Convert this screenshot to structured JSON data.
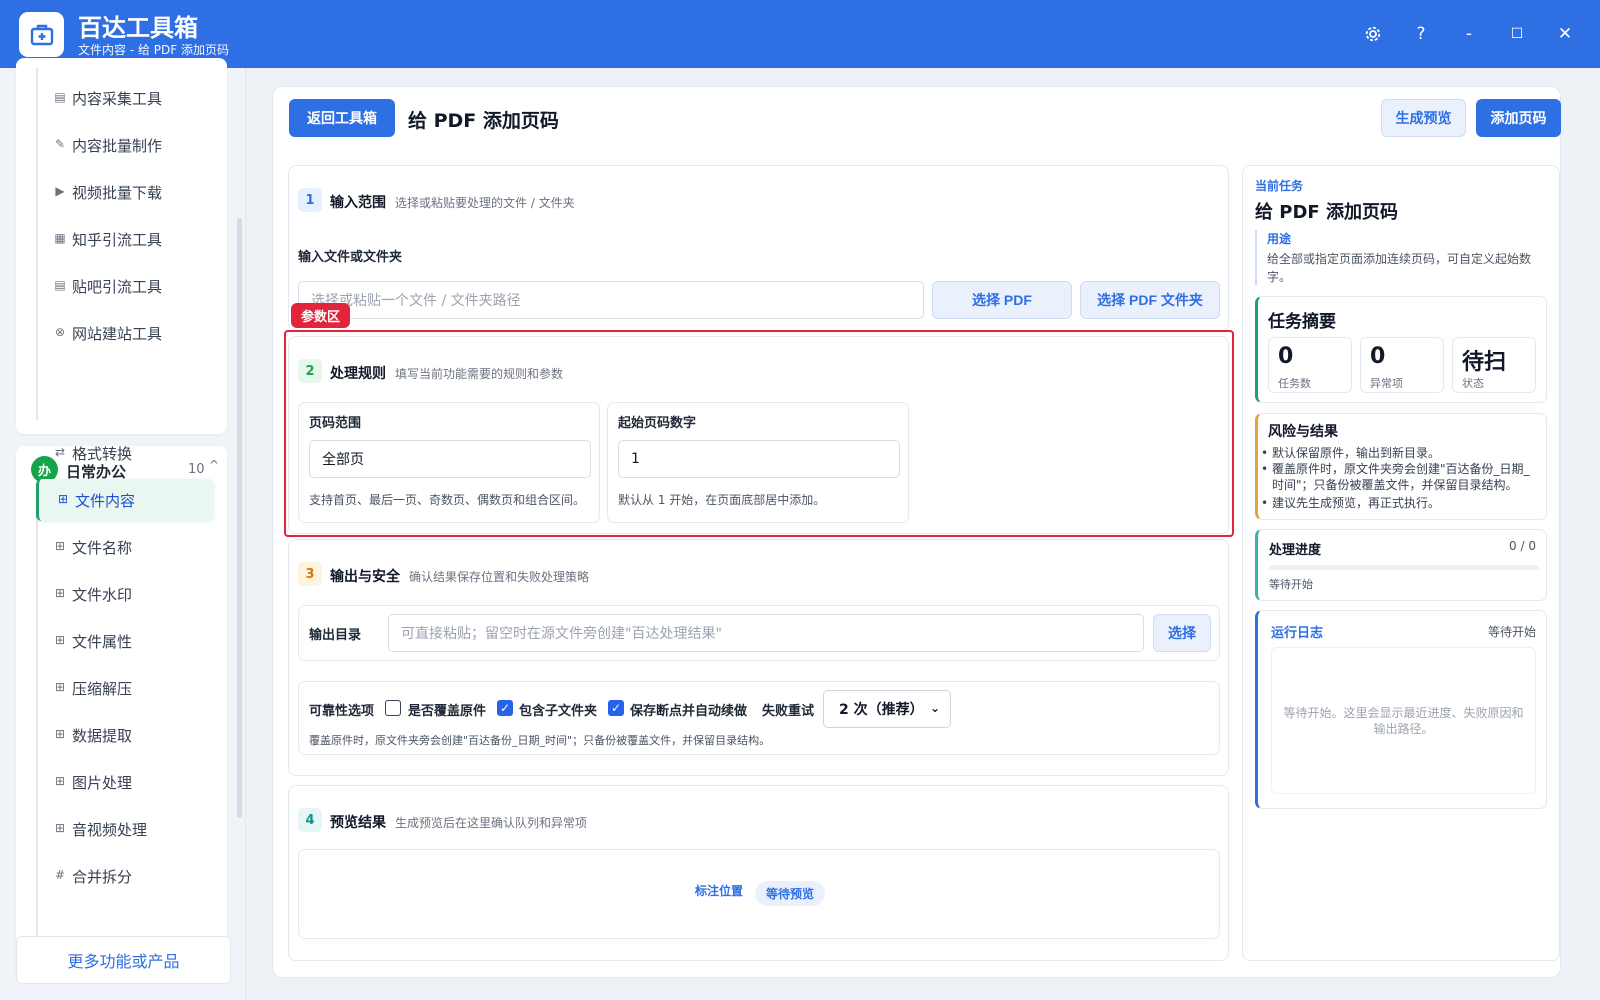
{
  "app": {
    "title": "百达工具箱",
    "subtitle": "文件内容 - 给 PDF 添加页码",
    "accent": "#2f6fe4"
  },
  "window_controls": {
    "settings_icon": "gear-icon",
    "help": "?",
    "minimize": "-",
    "maximize": "☐",
    "close": "✕"
  },
  "sidebar": {
    "top_items": [
      {
        "label": "内容采集工具",
        "icon": "collect-icon"
      },
      {
        "label": "内容批量制作",
        "icon": "pen-icon"
      },
      {
        "label": "视频批量下载",
        "icon": "video-icon"
      },
      {
        "label": "知乎引流工具",
        "icon": "zhihu-icon"
      },
      {
        "label": "贴吧引流工具",
        "icon": "tieba-icon"
      },
      {
        "label": "网站建站工具",
        "icon": "globe-icon"
      }
    ],
    "group": {
      "badge": "办",
      "label": "日常办公",
      "count": "10",
      "chevron": "^"
    },
    "group_items": [
      {
        "label": "格式转换",
        "icon": "swap-icon"
      },
      {
        "label": "文件内容",
        "icon": "grid-icon"
      },
      {
        "label": "文件名称",
        "icon": "grid-icon"
      },
      {
        "label": "文件水印",
        "icon": "grid-icon"
      },
      {
        "label": "文件属性",
        "icon": "grid-icon"
      },
      {
        "label": "压缩解压",
        "icon": "grid-icon"
      },
      {
        "label": "数据提取",
        "icon": "grid-icon"
      },
      {
        "label": "图片处理",
        "icon": "grid-icon"
      },
      {
        "label": "音视频处理",
        "icon": "grid-icon"
      },
      {
        "label": "合并拆分",
        "icon": "hash-icon"
      }
    ],
    "active_item": "文件内容",
    "more": "更多功能或产品"
  },
  "header": {
    "back_button": "返回工具箱",
    "title": "给 PDF 添加页码",
    "preview_button": "生成预览",
    "run_button": "添加页码"
  },
  "section1": {
    "num": "1",
    "title": "输入范围",
    "hint": "选择或粘贴要处理的文件 / 文件夹",
    "field_label": "输入文件或文件夹",
    "input_placeholder": "选择或粘贴一个文件 / 文件夹路径",
    "choose_pdf": "选择 PDF",
    "choose_folder": "选择 PDF 文件夹"
  },
  "highlight_tag": "参数区",
  "section2": {
    "num": "2",
    "title": "处理规则",
    "hint": "填写当前功能需要的规则和参数",
    "range_label": "页码范围",
    "range_value": "全部页",
    "range_help": "支持首页、最后一页、奇数页、偶数页和组合区间。",
    "start_label": "起始页码数字",
    "start_value": "1",
    "start_help": "默认从 1 开始，在页面底部居中添加。"
  },
  "section3": {
    "num": "3",
    "title": "输出与安全",
    "hint": "确认结果保存位置和失败处理策略",
    "output_label": "输出目录",
    "output_placeholder": "可直接粘贴；留空时在源文件旁创建\"百达处理结果\"",
    "choose": "选择",
    "options_label": "可靠性选项",
    "overwrite": {
      "label": "是否覆盖原件",
      "checked": false
    },
    "subfolders": {
      "label": "包含子文件夹",
      "checked": true
    },
    "resume": {
      "label": "保存断点并自动续做",
      "checked": true
    },
    "retry_label": "失败重试",
    "retry_value": "2 次（推荐）",
    "note": "覆盖原件时，原文件夹旁会创建\"百达备份_日期_时间\"；只备份被覆盖文件，并保留目录结构。"
  },
  "section4": {
    "num": "4",
    "title": "预览结果",
    "hint": "生成预览后在这里确认队列和异常项",
    "anchor": "标注位置",
    "status_pill": "等待预览"
  },
  "right": {
    "current_task_label": "当前任务",
    "task_title": "给 PDF 添加页码",
    "purpose_label": "用途",
    "purpose_text": "给全部或指定页面添加连续页码，可自定义起始数字。",
    "summary_title": "任务摘要",
    "kpis": [
      {
        "value": "0",
        "label": "任务数"
      },
      {
        "value": "0",
        "label": "异常项"
      },
      {
        "value": "待扫",
        "label": "状态"
      }
    ],
    "risk_title": "风险与结果",
    "risks": [
      "默认保留原件，输出到新目录。",
      "覆盖原件时，原文件夹旁会创建\"百达备份_日期_时间\"；只备份被覆盖文件，并保留目录结构。",
      "建议先生成预览，再正式执行。"
    ],
    "progress_title": "处理进度",
    "progress_count": "0 / 0",
    "progress_fraction": 0,
    "progress_status": "等待开始",
    "log_title": "运行日志",
    "log_status": "等待开始",
    "log_text": "等待开始。这里会显示最近进度、失败原因和输出路径。"
  }
}
